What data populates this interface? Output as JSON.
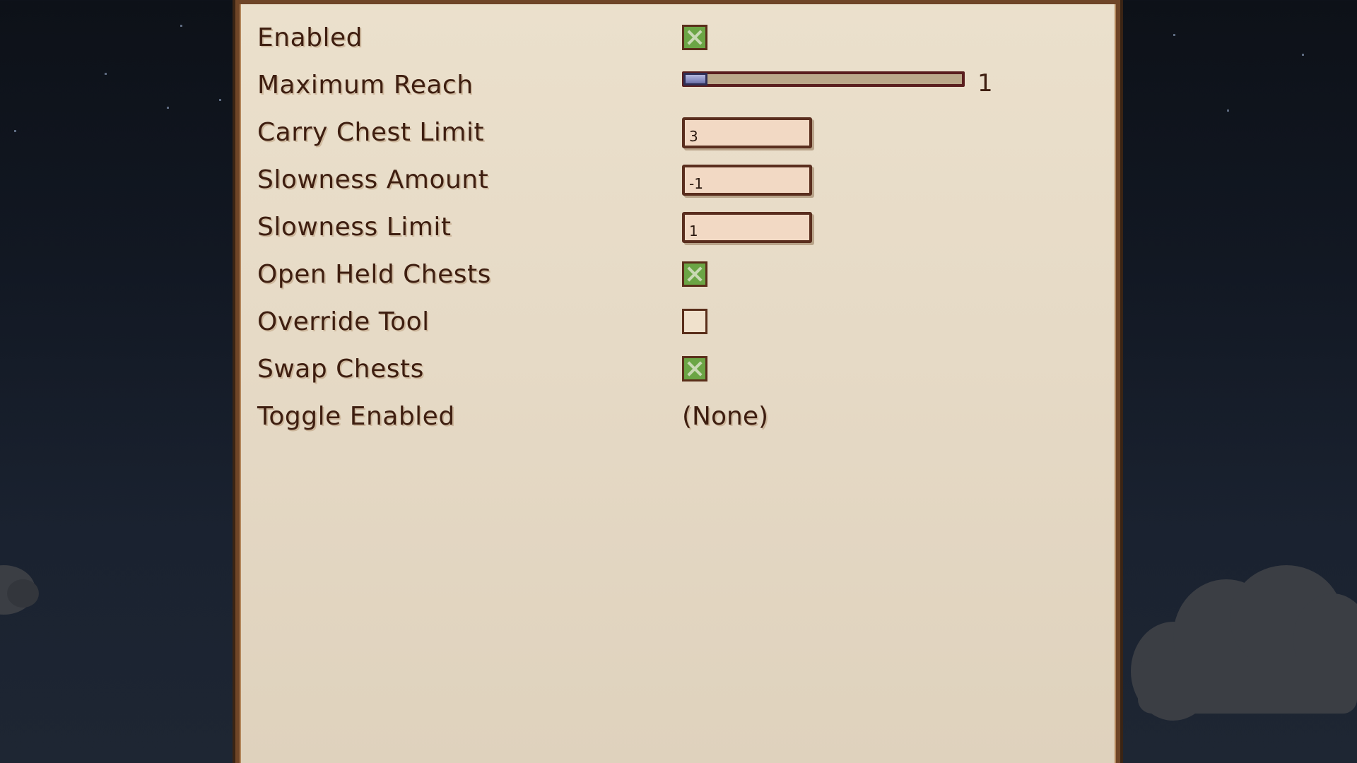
{
  "settings": {
    "enabled": {
      "label": "Enabled",
      "checked": true
    },
    "maximum_reach": {
      "label": "Maximum Reach",
      "value": "1",
      "fraction": 0.0
    },
    "carry_chest_limit": {
      "label": "Carry Chest Limit",
      "value": "3"
    },
    "slowness_amount": {
      "label": "Slowness Amount",
      "value": "-1"
    },
    "slowness_limit": {
      "label": "Slowness Limit",
      "value": "1"
    },
    "open_held_chests": {
      "label": "Open Held Chests",
      "checked": true
    },
    "override_tool": {
      "label": "Override Tool",
      "checked": false
    },
    "swap_chests": {
      "label": "Swap Chests",
      "checked": true
    },
    "toggle_enabled": {
      "label": "Toggle Enabled",
      "value": "(None)"
    }
  },
  "colors": {
    "panel_background": "#e6dac6",
    "panel_border": "#6f4527",
    "text": "#3e1e10",
    "checkbox_checked": "#6ba545",
    "slider_thumb": "#8b90c4",
    "textbox_background": "#f2d9c4",
    "night_sky": "#121823"
  }
}
